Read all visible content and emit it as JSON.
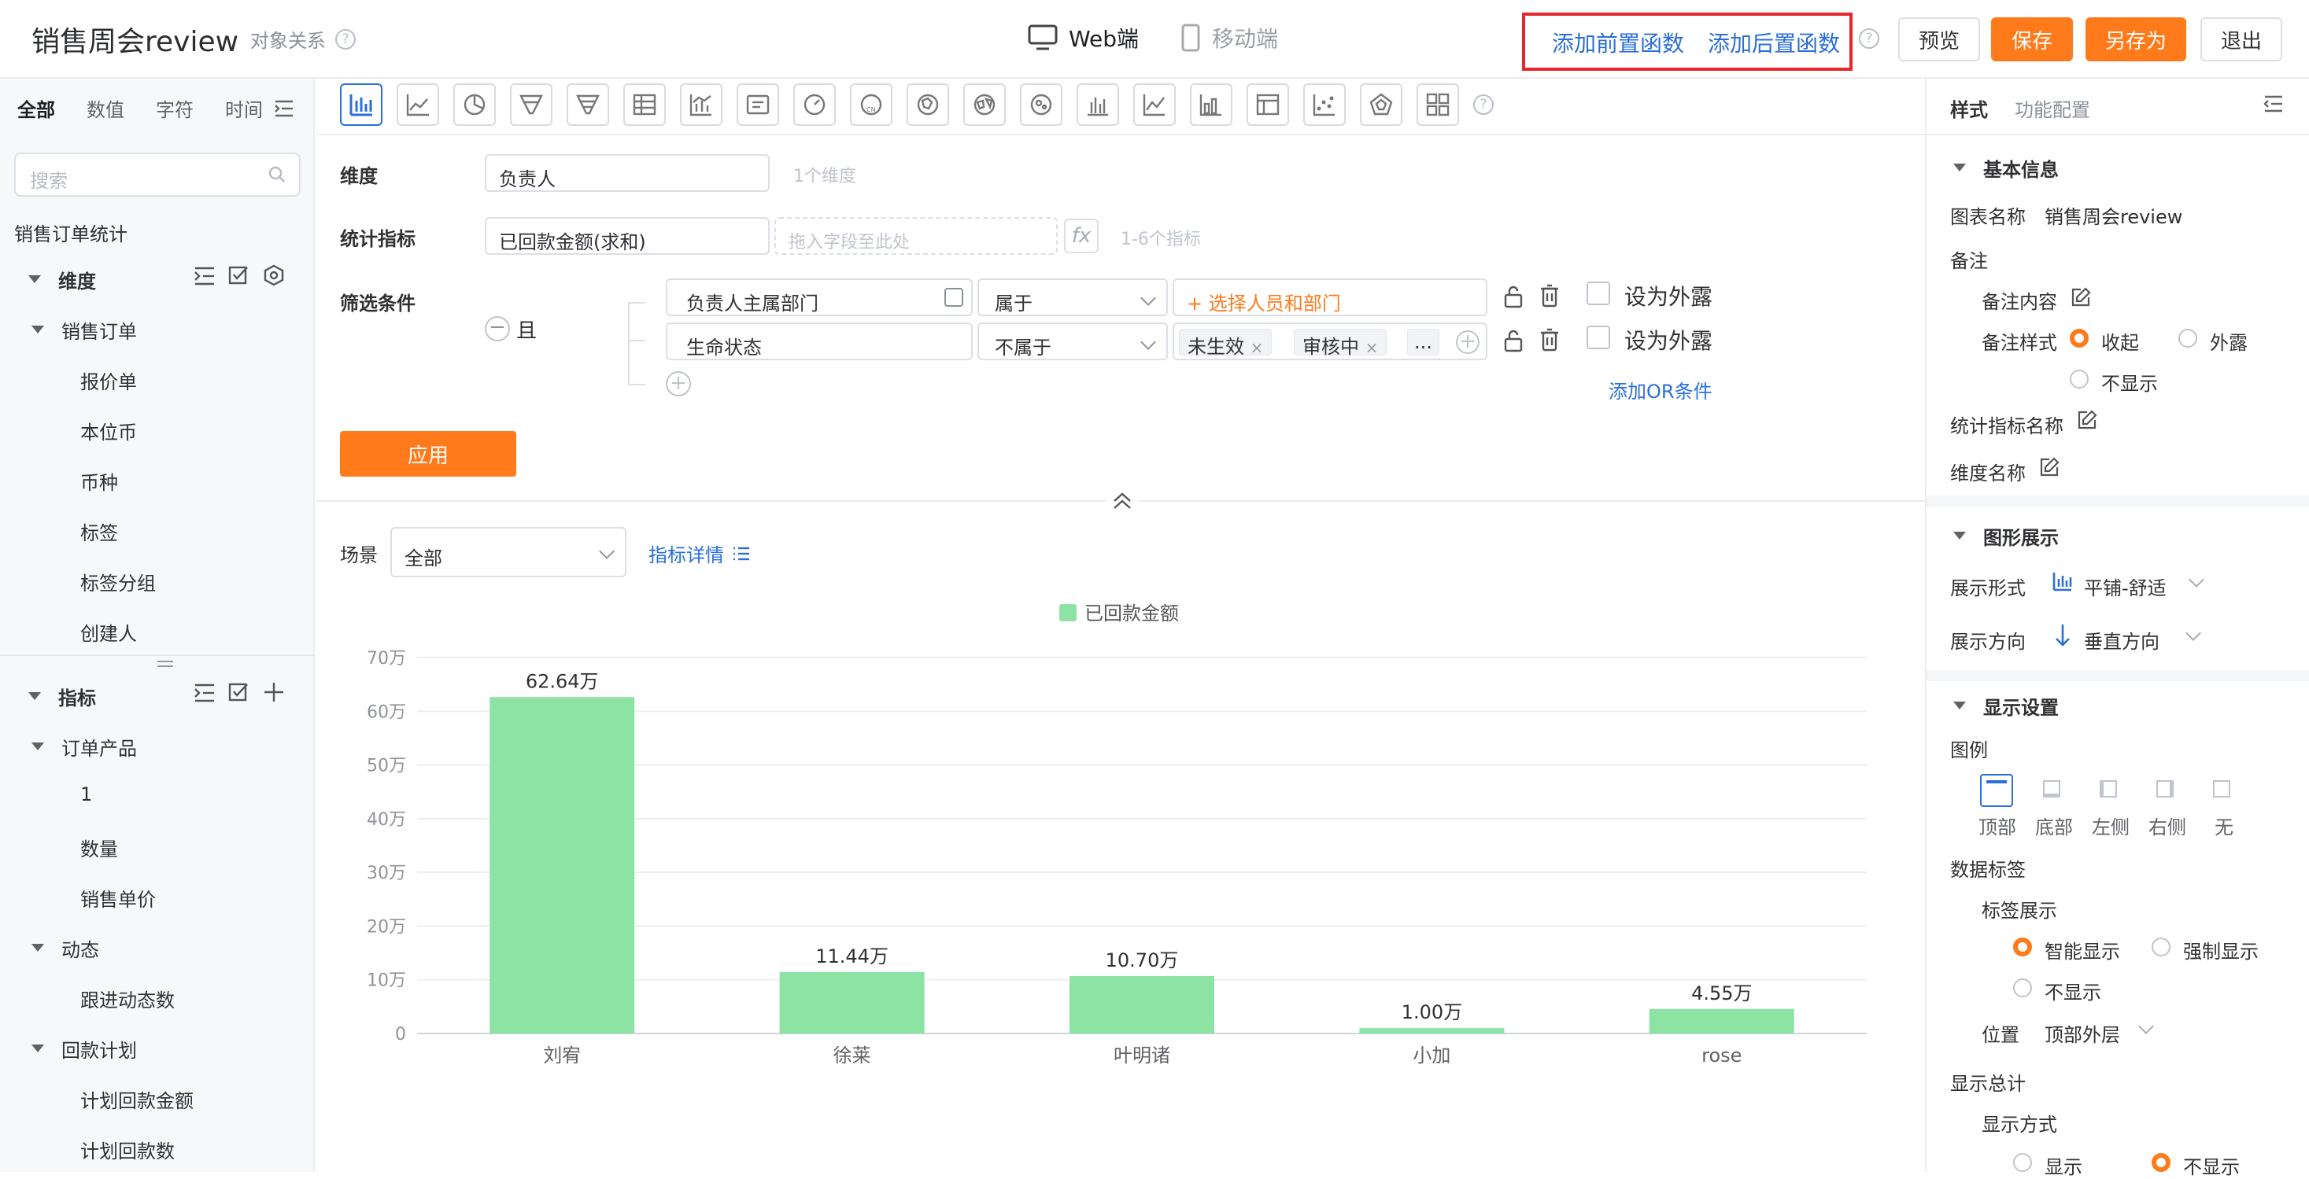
{
  "header": {
    "title": "销售周会review",
    "relation": "对象关系",
    "web_label": "Web端",
    "mobile_label": "移动端",
    "add_pre_func": "添加前置函数",
    "add_post_func": "添加后置函数",
    "preview": "预览",
    "save": "保存",
    "save_as": "另存为",
    "exit": "退出"
  },
  "left": {
    "tabs": [
      "全部",
      "数值",
      "字符",
      "时间"
    ],
    "search_placeholder": "搜索",
    "dataset": "销售订单统计",
    "dim_group": "维度",
    "dim_sub": "销售订单",
    "dim_items": [
      "报价单",
      "本位币",
      "币种",
      "标签",
      "标签分组",
      "创建人"
    ],
    "metric_group": "指标",
    "metric_sub1": "订单产品",
    "metric_items1": [
      "1",
      "数量",
      "销售单价"
    ],
    "metric_sub2": "动态",
    "metric_items2": [
      "跟进动态数"
    ],
    "metric_sub3": "回款计划",
    "metric_items3": [
      "计划回款金额",
      "计划回款数"
    ]
  },
  "config": {
    "dimension_label": "维度",
    "dimension_value": "负责人",
    "dimension_hint": "1个维度",
    "metric_label": "统计指标",
    "metric_value": "已回款金额(求和)",
    "metric_drop": "拖入字段至此处",
    "metric_fx": "fx",
    "metric_hint": "1-6个指标",
    "filter_label": "筛选条件",
    "filter_and": "且",
    "filter1_field": "负责人主属部门",
    "filter1_op": "属于",
    "filter1_value": "+ 选择人员和部门",
    "filter2_field": "生命状态",
    "filter2_op": "不属于",
    "filter2_tag1": "未生效",
    "filter2_tag2": "审核中",
    "filter2_more": "...",
    "expose": "设为外露",
    "add_or": "添加OR条件",
    "apply": "应用",
    "scene_label": "场景",
    "scene_value": "全部",
    "metric_detail": "指标详情"
  },
  "chart_data": {
    "type": "bar",
    "legend": "已回款金额",
    "legend_position": "top",
    "categories": [
      "刘宥",
      "徐莱",
      "叶明诸",
      "小加",
      "rose"
    ],
    "values": [
      62.64,
      11.44,
      10.7,
      1.0,
      4.55
    ],
    "value_labels": [
      "62.64万",
      "11.44万",
      "10.70万",
      "1.00万",
      "4.55万"
    ],
    "yticks": [
      "0",
      "10万",
      "20万",
      "30万",
      "40万",
      "50万",
      "60万",
      "70万"
    ],
    "ylim": [
      0,
      70
    ],
    "bar_color": "#8ce3a4",
    "grid": true
  },
  "right": {
    "tab_style": "样式",
    "tab_func": "功能配置",
    "basic_info": "基本信息",
    "chart_name_label": "图表名称",
    "chart_name_value": "销售周会review",
    "remark": "备注",
    "remark_content": "备注内容",
    "remark_style": "备注样式",
    "opt_collapse": "收起",
    "opt_expose": "外露",
    "opt_hide": "不显示",
    "metric_name": "统计指标名称",
    "dim_name": "维度名称",
    "graph_display": "图形展示",
    "display_form": "展示形式",
    "display_form_value": "平铺-舒适",
    "display_dir": "展示方向",
    "display_dir_value": "垂直方向",
    "display_settings": "显示设置",
    "legend": "图例",
    "legend_opts": [
      "顶部",
      "底部",
      "左侧",
      "右侧",
      "无"
    ],
    "data_label": "数据标签",
    "label_display": "标签展示",
    "smart_show": "智能显示",
    "force_show": "强制显示",
    "no_show": "不显示",
    "position": "位置",
    "position_value": "顶部外层",
    "show_total": "显示总计",
    "show_mode": "显示方式",
    "show": "显示",
    "hide": "不显示"
  }
}
